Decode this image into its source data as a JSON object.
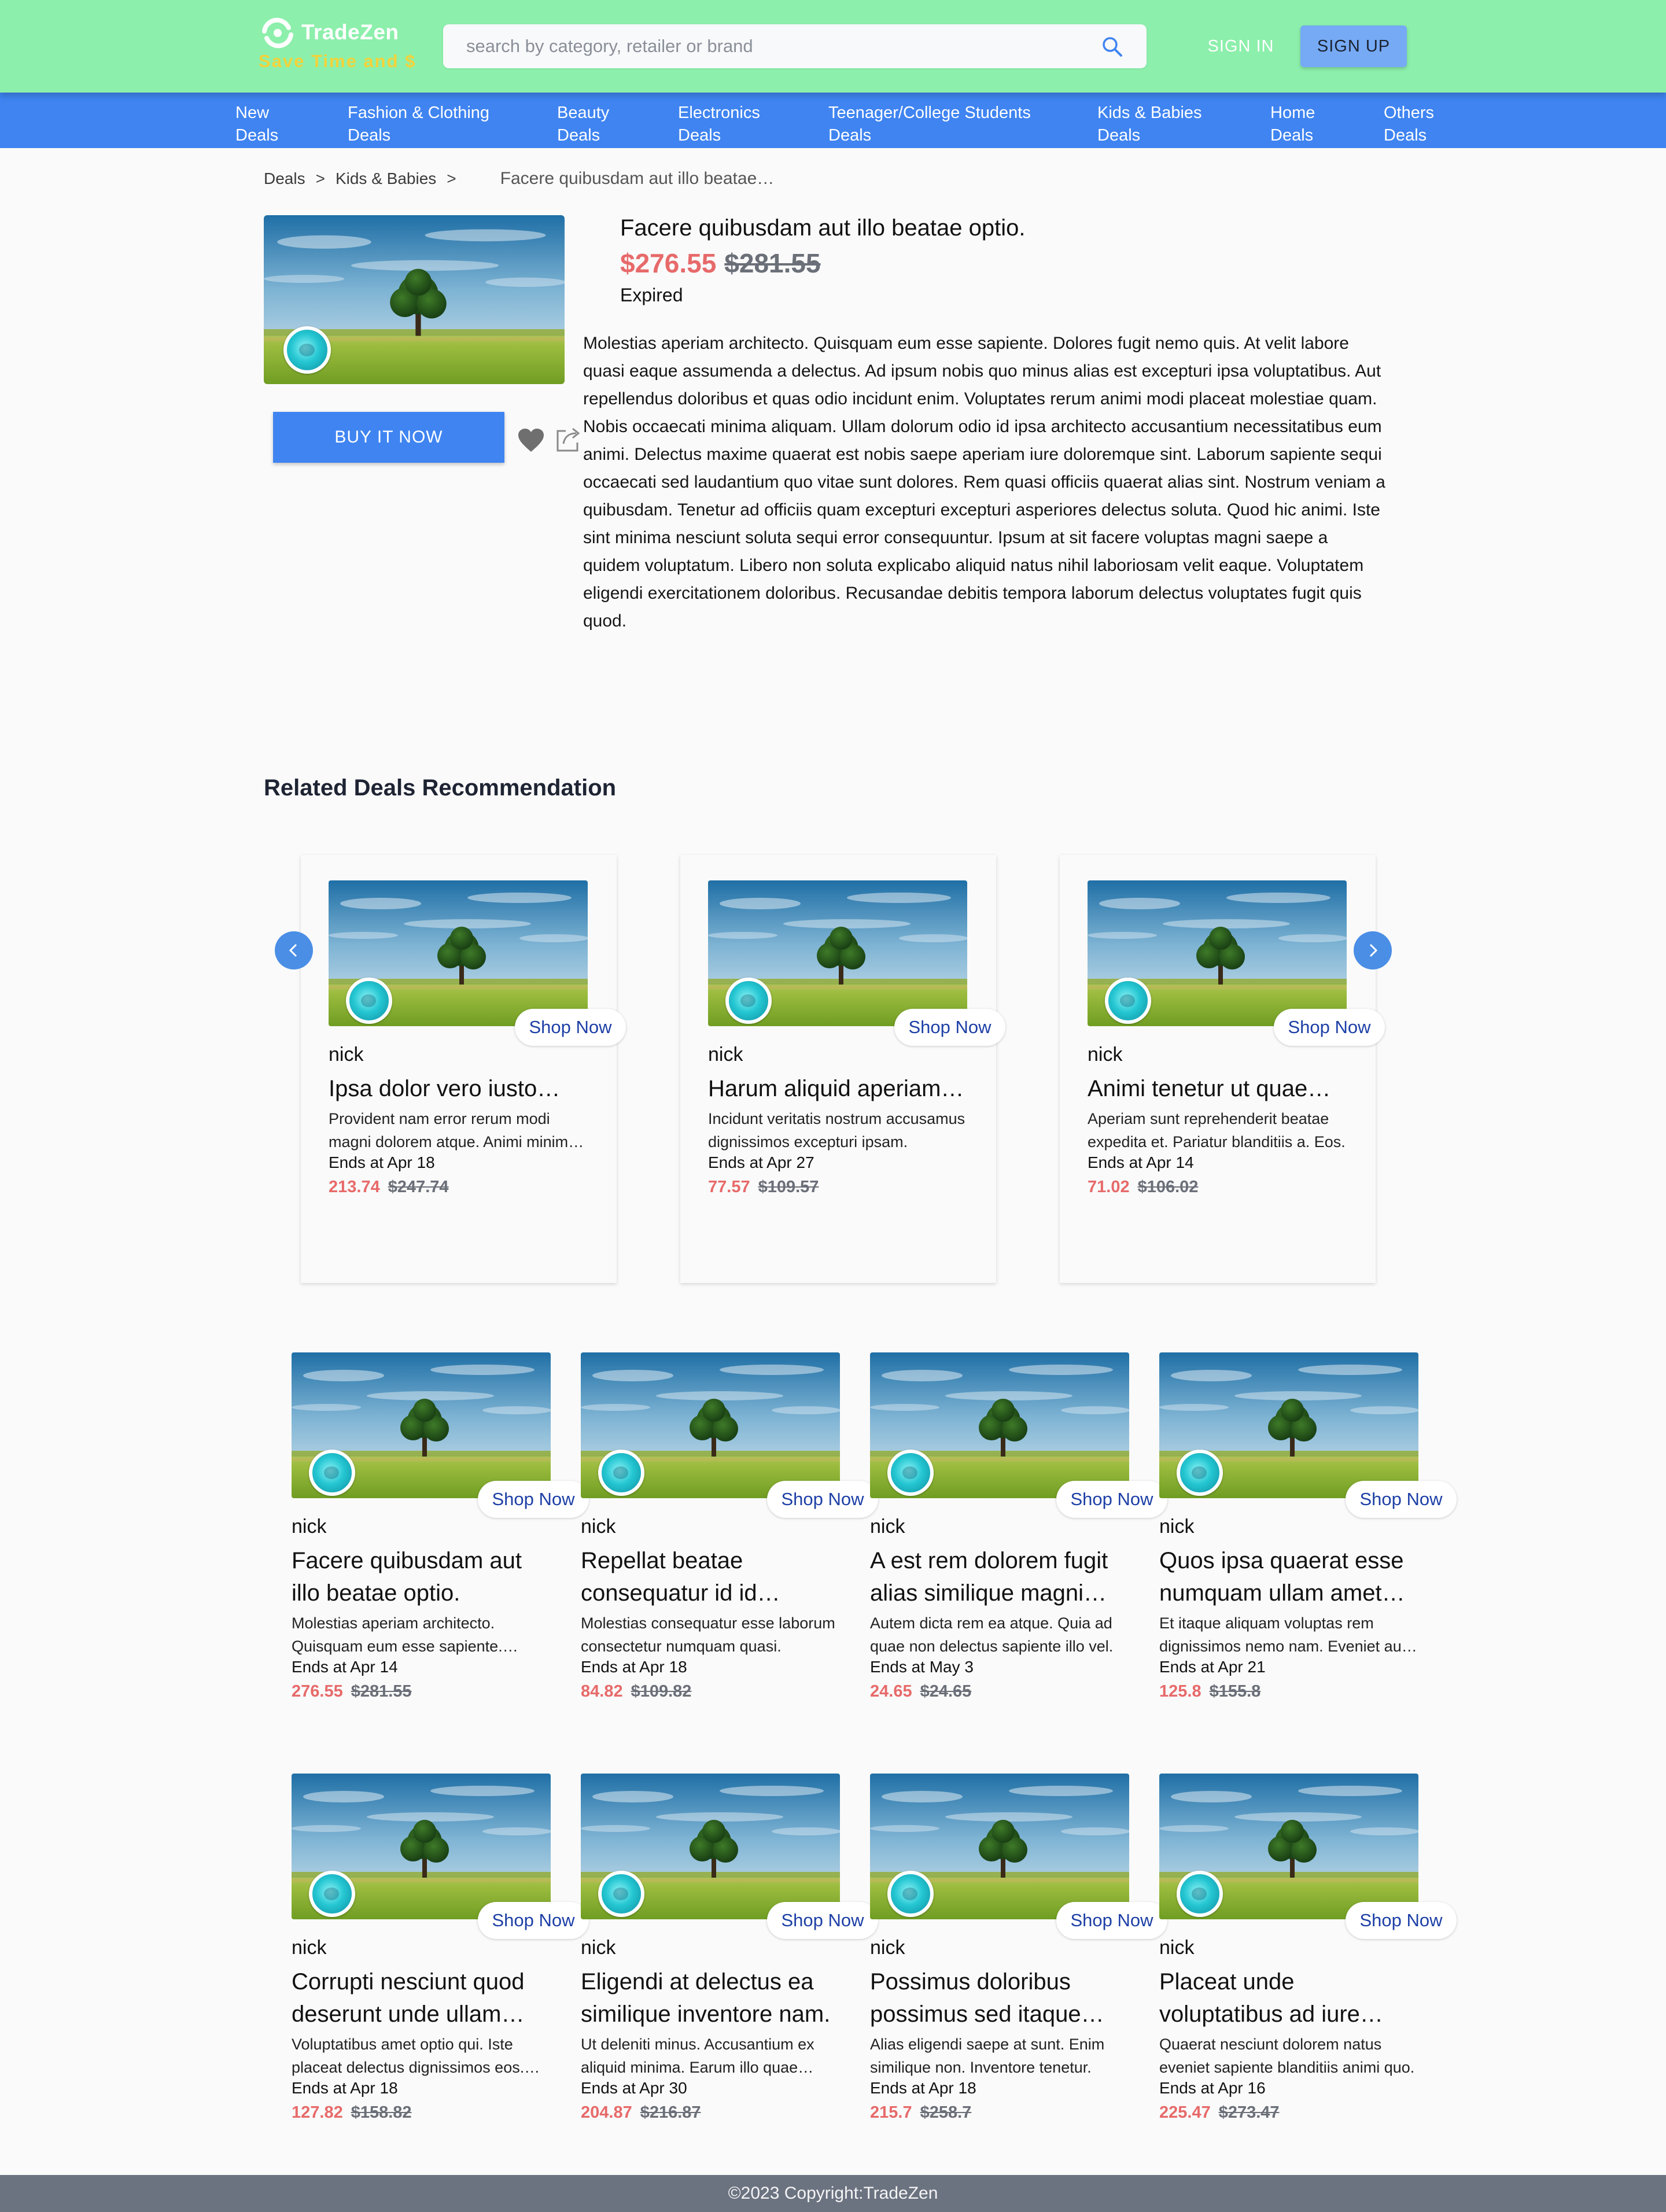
{
  "header": {
    "brand_name": "TradeZen",
    "tagline": "Save Time and $",
    "search_placeholder": "search by category, retailer or brand",
    "sign_in_label": "SIGN IN",
    "sign_up_label": "SIGN UP"
  },
  "nav": [
    {
      "line1": "New",
      "line2": "Deals"
    },
    {
      "line1": "Fashion & Clothing",
      "line2": "Deals"
    },
    {
      "line1": "Beauty",
      "line2": "Deals"
    },
    {
      "line1": "Electronics",
      "line2": "Deals"
    },
    {
      "line1": "Teenager/College Students",
      "line2": "Deals"
    },
    {
      "line1": "Kids & Babies",
      "line2": "Deals"
    },
    {
      "line1": "Home",
      "line2": "Deals"
    },
    {
      "line1": "Others",
      "line2": "Deals"
    }
  ],
  "breadcrumb": {
    "items": [
      "Deals",
      "Kids & Babies"
    ],
    "separator": ">",
    "current": "Facere quibusdam aut illo beatae…"
  },
  "detail": {
    "title": "Facere quibusdam aut illo beatae optio.",
    "price": "$276.55",
    "original_price": "$281.55",
    "status": "Expired",
    "buy_label": "BUY IT NOW",
    "description": "Molestias aperiam architecto. Quisquam eum esse sapiente. Dolores fugit nemo quis. At velit labore quasi eaque assumenda a delectus. Ad ipsum nobis quo minus alias est excepturi ipsa voluptatibus. Aut repellendus doloribus et quas odio incidunt enim. Voluptates rerum animi modi placeat molestiae quam. Nobis occaecati minima aliquam. Ullam dolorum odio id ipsa architecto accusantium necessitatibus eum animi. Delectus maxime quaerat est nobis saepe aperiam iure doloremque sint. Laborum sapiente sequi occaecati sed laudantium quo vitae sunt dolores. Rem quasi officiis quaerat alias sint. Nostrum veniam a quibusdam. Tenetur ad officiis quam excepturi excepturi asperiores delectus soluta. Quod hic animi. Iste sint minima nesciunt soluta sequi error consequuntur. Ipsum at sit facere voluptas magni saepe a quidem voluptatum. Libero non soluta explicabo aliquid natus nihil laboriosam velit eaque. Voluptatem eligendi exercitationem doloribus. Recusandae debitis tempora laborum delectus voluptates fugit quis quod."
  },
  "related": {
    "title": "Related Deals Recommendation",
    "shop_label": "Shop Now",
    "carousel": [
      {
        "author": "nick",
        "title": "Ipsa dolor vero iusto laborum.",
        "desc": "Provident nam error rerum modi magni dolorem atque. Animi minima nemo.",
        "ends": "Ends at Apr 18",
        "price": "213.74",
        "was": "$247.74"
      },
      {
        "author": "nick",
        "title": "Harum aliquid aperiam officia.",
        "desc": "Incidunt veritatis nostrum accusamus dignissimos excepturi ipsam.",
        "ends": "Ends at Apr 27",
        "price": "77.57",
        "was": "$109.57"
      },
      {
        "author": "nick",
        "title": "Animi tenetur ut quae enim.",
        "desc": "Aperiam sunt reprehenderit beatae expedita et. Pariatur blanditiis a. Eos.",
        "ends": "Ends at Apr 14",
        "price": "71.02",
        "was": "$106.02"
      }
    ],
    "grid": [
      {
        "author": "nick",
        "title": "Facere quibusdam aut illo beatae optio.",
        "desc": "Molestias aperiam architecto. Quisquam eum esse sapiente. Dolores fugit.",
        "ends": "Ends at Apr 14",
        "price": "276.55",
        "was": "$281.55"
      },
      {
        "author": "nick",
        "title": "Repellat beatae consequatur id id voluptas.",
        "desc": "Molestias consequatur esse laborum consectetur numquam quasi.",
        "ends": "Ends at Apr 18",
        "price": "84.82",
        "was": "$109.82"
      },
      {
        "author": "nick",
        "title": "A est rem dolorem fugit alias similique magni eius.",
        "desc": "Autem dicta rem ea atque. Quia ad quae non delectus sapiente illo vel.",
        "ends": "Ends at May 3",
        "price": "24.65",
        "was": "$24.65"
      },
      {
        "author": "nick",
        "title": "Quos ipsa quaerat esse numquam ullam amet sint.",
        "desc": "Et itaque aliquam voluptas rem dignissimos nemo nam. Eveniet aut quis.",
        "ends": "Ends at Apr 21",
        "price": "125.8",
        "was": "$155.8"
      },
      {
        "author": "nick",
        "title": "Corrupti nesciunt quod deserunt unde ullam iure.",
        "desc": "Voluptatibus amet optio qui. Iste placeat delectus dignissimos eos. Sint.",
        "ends": "Ends at Apr 18",
        "price": "127.82",
        "was": "$158.82"
      },
      {
        "author": "nick",
        "title": "Eligendi at delectus ea similique inventore nam.",
        "desc": "Ut deleniti minus. Accusantium ex aliquid minima. Earum illo quae rerum.",
        "ends": "Ends at Apr 30",
        "price": "204.87",
        "was": "$216.87"
      },
      {
        "author": "nick",
        "title": "Possimus doloribus possimus sed itaque minus.",
        "desc": "Alias eligendi saepe at sunt. Enim similique non. Inventore tenetur.",
        "ends": "Ends at Apr 18",
        "price": "215.7",
        "was": "$258.7"
      },
      {
        "author": "nick",
        "title": "Placeat unde voluptatibus ad iure ratione.",
        "desc": "Quaerat nesciunt dolorem natus eveniet sapiente blanditiis animi quo.",
        "ends": "Ends at Apr 16",
        "price": "225.47",
        "was": "$273.47"
      }
    ]
  },
  "footer": {
    "text": "©2023 Copyright:TradeZen"
  },
  "colors": {
    "header_bg": "#8cefab",
    "nav_bg": "#3f84f1",
    "price": "#e76a6a",
    "tagline": "#f3d33b",
    "footer_bg": "#6b7280"
  },
  "icons": [
    "logo-mark-icon",
    "search-icon",
    "heart-icon",
    "share-icon",
    "chevron-left-icon",
    "chevron-right-icon"
  ]
}
